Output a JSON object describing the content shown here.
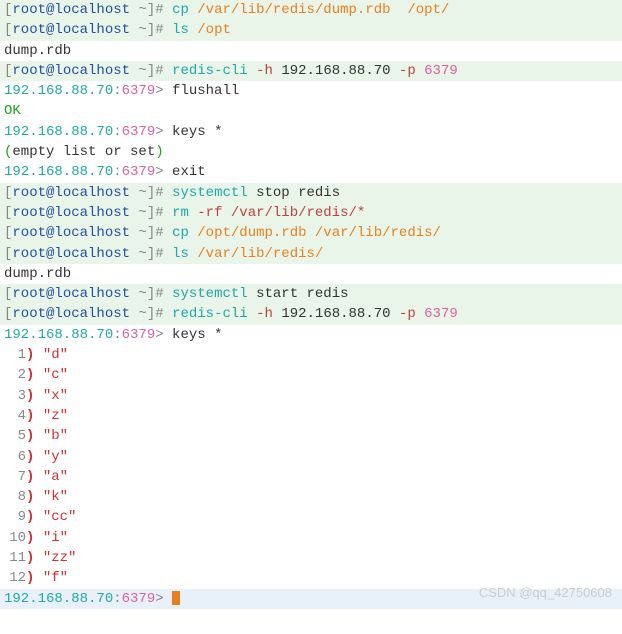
{
  "prompt": {
    "open": "[",
    "user": "root@localhost",
    "close": " ~]",
    "hash": "#"
  },
  "redis_prompt": {
    "host": "192.168.88.70",
    "sep": ":",
    "port": "6379",
    "gt": ">"
  },
  "cmds": {
    "cp": "cp",
    "ls": "ls",
    "rm": "rm",
    "rediscli": "redis-cli",
    "systemctl": "systemctl",
    "flushall": "flushall",
    "keys": "keys",
    "exit": "exit",
    "star": "*",
    "stop_redis": "stop redis",
    "start_redis": "start redis"
  },
  "args": {
    "dump_src": "/var/lib/redis/dump.rdb  /opt/",
    "opt": "/opt",
    "h_flag": "-h",
    "p_flag": "-p",
    "host": "192.168.88.70",
    "port": "6379",
    "rf": "-rf /var/lib/redis/*",
    "cp2": "/opt/dump.rdb /var/lib/redis/",
    "ls2": "/var/lib/redis/"
  },
  "out": {
    "dump": "dump.rdb",
    "ok": "OK",
    "empty_open": "(",
    "empty_text": "empty list or set",
    "empty_close": ")"
  },
  "keys_result": [
    {
      "n": "1",
      "v": "\"d\""
    },
    {
      "n": "2",
      "v": "\"c\""
    },
    {
      "n": "3",
      "v": "\"x\""
    },
    {
      "n": "4",
      "v": "\"z\""
    },
    {
      "n": "5",
      "v": "\"b\""
    },
    {
      "n": "6",
      "v": "\"y\""
    },
    {
      "n": "7",
      "v": "\"a\""
    },
    {
      "n": "8",
      "v": "\"k\""
    },
    {
      "n": "9",
      "v": "\"cc\""
    },
    {
      "n": "10",
      "v": "\"i\""
    },
    {
      "n": "11",
      "v": "\"zz\""
    },
    {
      "n": "12",
      "v": "\"f\""
    }
  ],
  "paren": ")",
  "watermark": "CSDN @qq_42750608"
}
